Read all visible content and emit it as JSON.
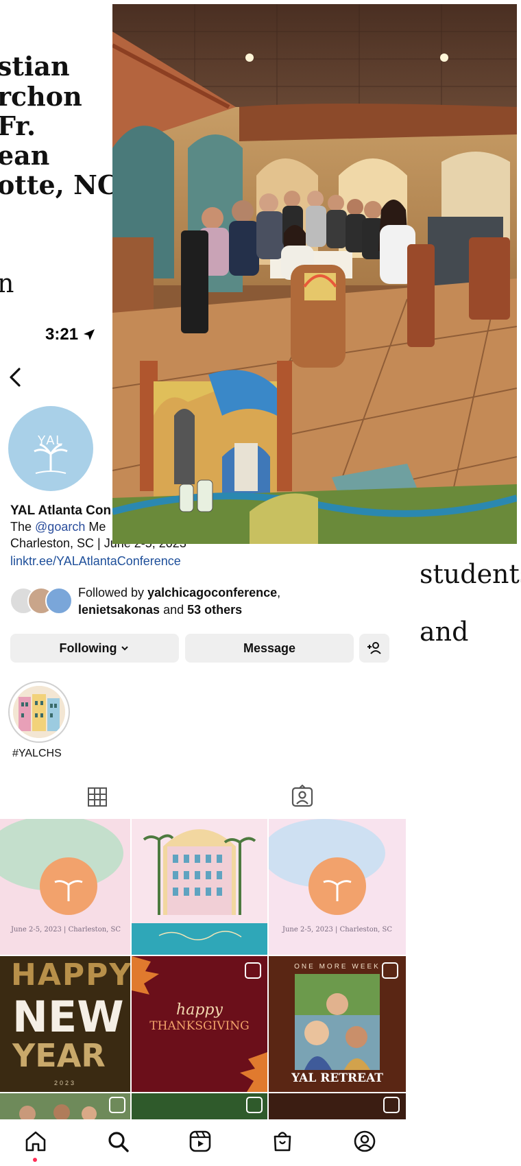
{
  "document": {
    "fragments": [
      "stian",
      "rchon",
      "Fr.",
      "ean",
      "otte, NC",
      "n"
    ],
    "right_words": [
      "students",
      "and"
    ]
  },
  "status_bar": {
    "time": "3:21"
  },
  "profile": {
    "avatar_text": "YAL",
    "name": "YAL Atlanta Con",
    "bio_prefix": "The ",
    "bio_mention": "@goarch",
    "bio_suffix": " Me",
    "bio_line2": "Charleston, SC | June 2-5, 2023",
    "link": "linktr.ee/YALAtlantaConference",
    "followed_by_prefix": "Followed by ",
    "followed_user1": "yalchicagoconference",
    "followed_sep": ",",
    "followed_user2": "lenietsakonas",
    "followed_and": " and ",
    "followed_others": "53 others"
  },
  "buttons": {
    "following": "Following",
    "message": "Message"
  },
  "highlight": {
    "label": "#YALCHS"
  },
  "posts": {
    "caption1": "June 2-5, 2023 | Charleston, SC",
    "caption3": "June 2-5, 2023 | Charleston, SC",
    "happy": "HAPPY",
    "new": "NEW",
    "year": "YEAR",
    "year_num": "2023",
    "happy_script": "happy",
    "thanksgiving": "THANKSGIVING",
    "one_more_week": "ONE MORE WEEK",
    "retreat": "YAL RETREAT"
  },
  "colors": {
    "link": "#1e4f9a",
    "button_bg": "#efefef",
    "notification_dot": "#ff2d55",
    "avatar_bg": "#a9d0e8"
  }
}
